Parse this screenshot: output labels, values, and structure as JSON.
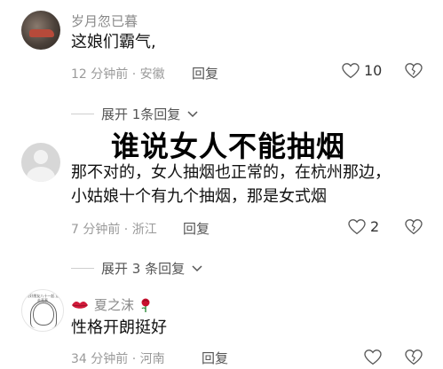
{
  "comments": [
    {
      "username": "岁月忽已暮",
      "text": "这娘们霸气,",
      "meta": "12 分钟前 · 安徽",
      "reply_label": "回复",
      "like_count": "10"
    },
    {
      "text_line1": "那不对的，女人抽烟也正常的，在杭州那边，",
      "text_line2": "小姑娘十个有九个抽烟，那是女式烟",
      "meta": "7 分钟前 · 浙江",
      "reply_label": "回复",
      "like_count": "2"
    },
    {
      "username": "夏之沫",
      "text": "性格开朗挺好",
      "meta": "34 分钟前 · 河南",
      "reply_label": "回复",
      "avatar_caption": "与好朋友八十一起 送走青春",
      "badge_left_icon": "lips-icon",
      "badge_right_icon": "rose-icon"
    }
  ],
  "expand": [
    {
      "label": "展开 1条回复"
    },
    {
      "label": "展开 3 条回复"
    }
  ],
  "overlay_title": "谁说女人不能抽烟",
  "colors": {
    "text_primary": "#111111",
    "text_secondary": "#9a9a9a",
    "username": "#8a8a8a"
  }
}
